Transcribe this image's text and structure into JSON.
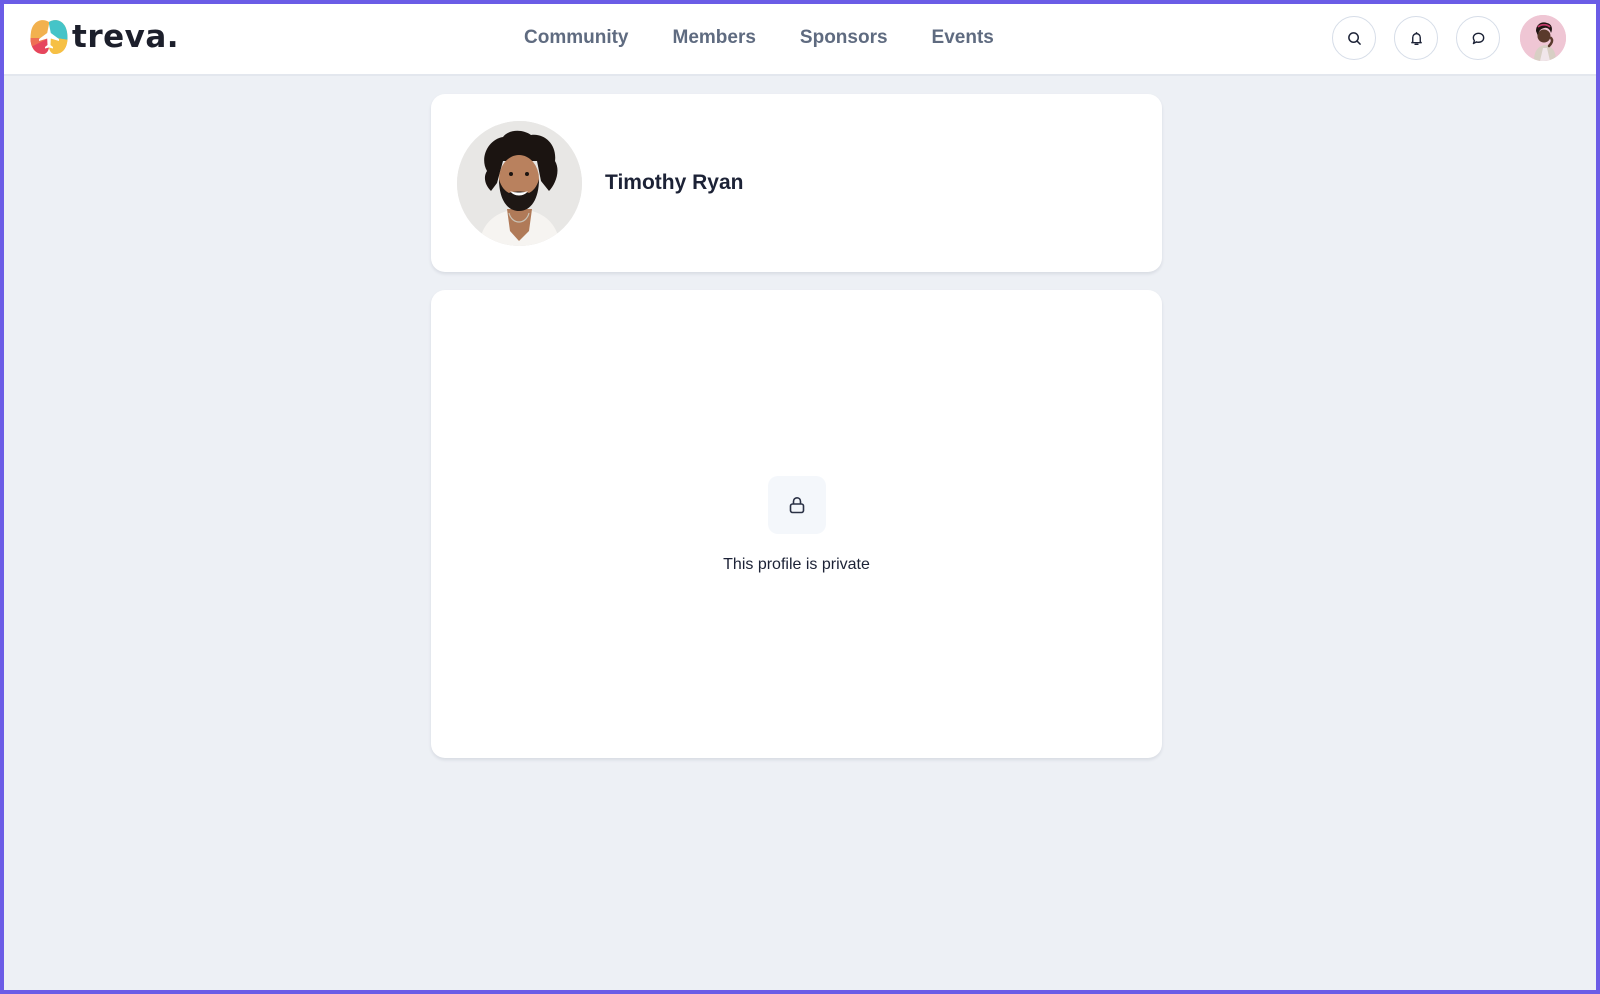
{
  "app": {
    "brand_name": "treva.",
    "frame_color": "#6b5ce6"
  },
  "header": {
    "nav": [
      {
        "label": "Community"
      },
      {
        "label": "Members"
      },
      {
        "label": "Sponsors"
      },
      {
        "label": "Events"
      }
    ],
    "actions": [
      {
        "name": "search",
        "icon": "search-icon"
      },
      {
        "name": "notifications",
        "icon": "bell-icon"
      },
      {
        "name": "messages",
        "icon": "chat-bubble-icon"
      }
    ],
    "user_avatar": {
      "icon": "user-avatar"
    }
  },
  "profile": {
    "name": "Timothy Ryan",
    "avatar": "profile-photo"
  },
  "privacy": {
    "icon": "lock-icon",
    "message": "This profile is private"
  }
}
